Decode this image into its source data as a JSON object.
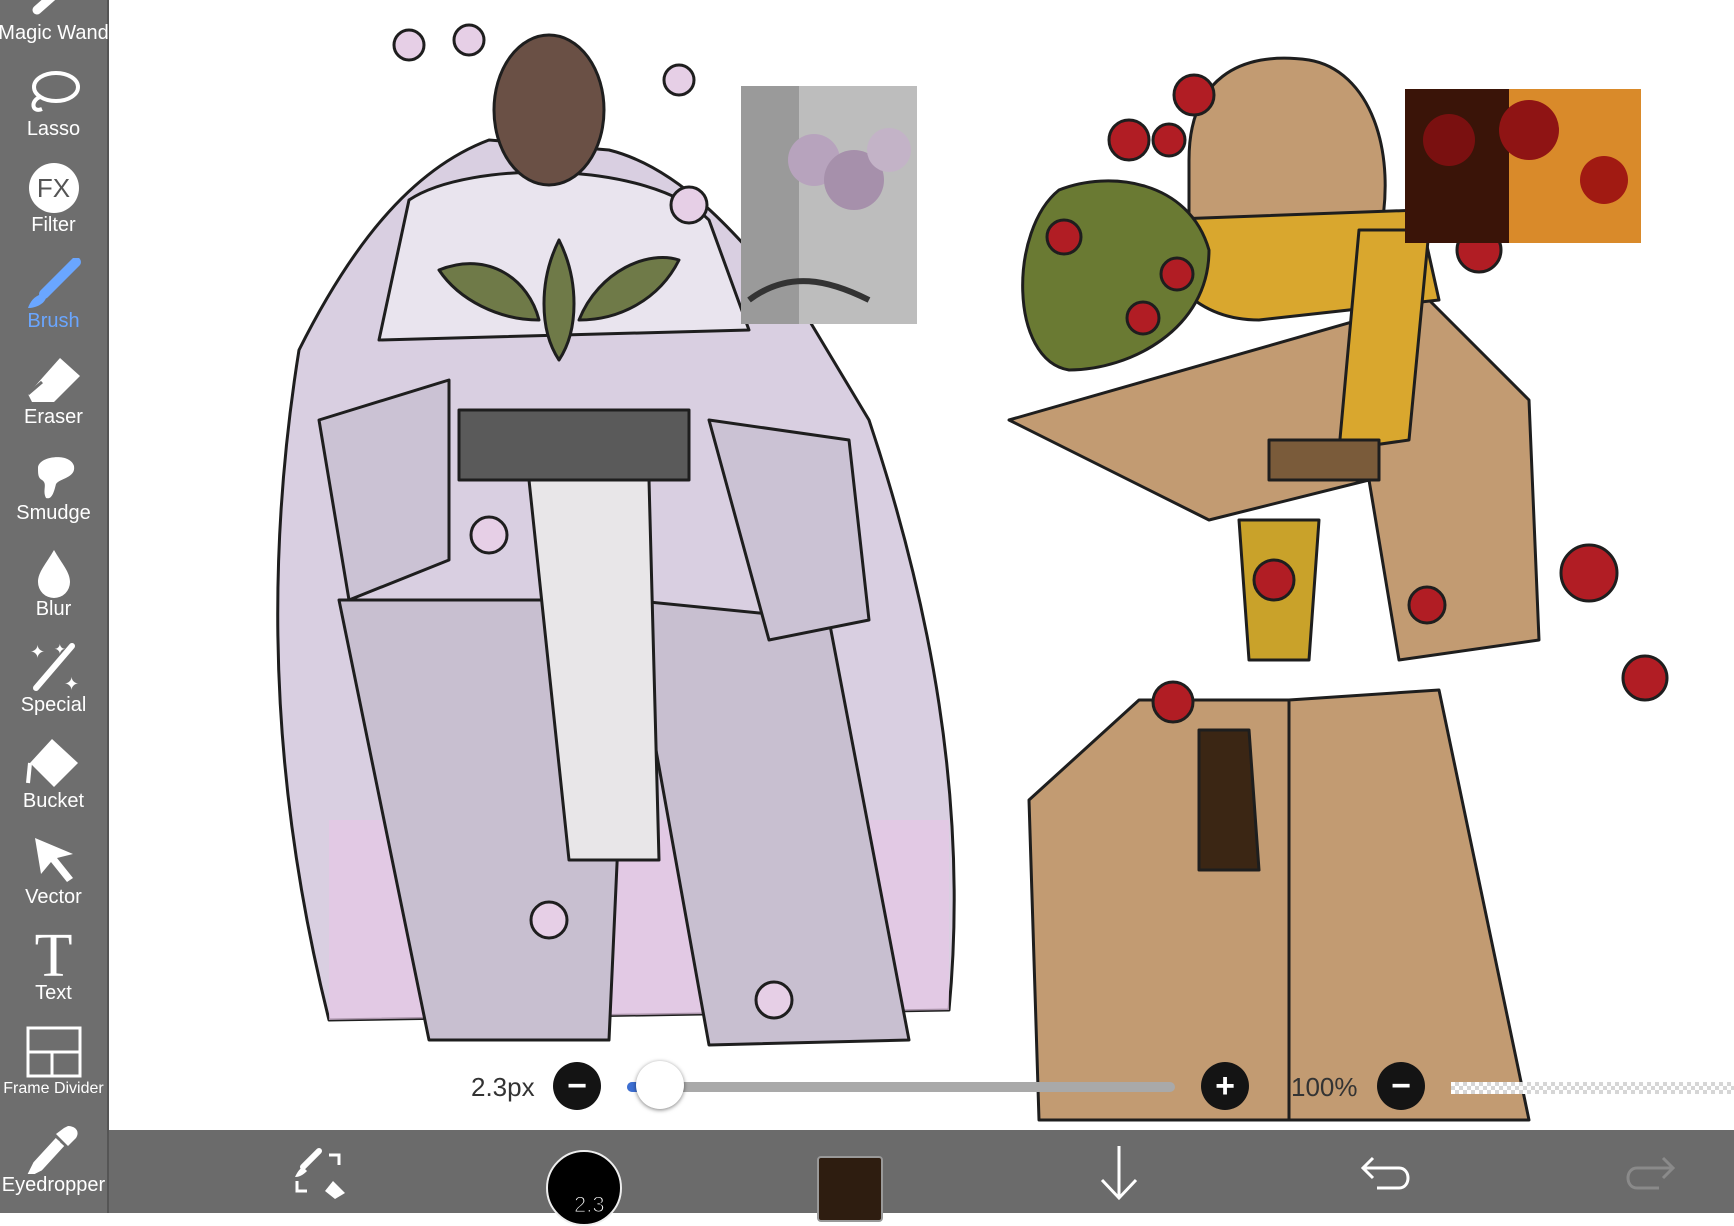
{
  "toolbar": {
    "items": [
      {
        "label": "Magic Wand",
        "icon": "magic-wand-icon"
      },
      {
        "label": "Lasso",
        "icon": "lasso-icon"
      },
      {
        "label": "Filter",
        "icon": "fx-icon",
        "icon_text": "FX"
      },
      {
        "label": "Brush",
        "icon": "brush-icon",
        "active": true
      },
      {
        "label": "Eraser",
        "icon": "eraser-icon"
      },
      {
        "label": "Smudge",
        "icon": "smudge-icon"
      },
      {
        "label": "Blur",
        "icon": "blur-drop-icon"
      },
      {
        "label": "Special",
        "icon": "sparkle-icon"
      },
      {
        "label": "Bucket",
        "icon": "bucket-icon"
      },
      {
        "label": "Vector",
        "icon": "pointer-icon"
      },
      {
        "label": "Text",
        "icon": "text-icon",
        "icon_text": "T"
      },
      {
        "label": "Frame Divider",
        "icon": "frame-divider-icon"
      },
      {
        "label": "Eyedropper",
        "icon": "eyedropper-icon"
      }
    ],
    "active_color": "#6aa6ff"
  },
  "brush_bar": {
    "size_label": "2.3px",
    "size_value": 2.3,
    "size_fraction": 0.06,
    "minus": "−",
    "plus": "+",
    "opacity_label": "100%",
    "opacity_minus": "−"
  },
  "bottom_bar": {
    "brush_size_text": "2.3",
    "current_color": "#2e1d10"
  },
  "canvas": {
    "left_figure_palette": [
      "#d4c8dc",
      "#6f7a48",
      "#5a5a5a",
      "#e8b9e0"
    ],
    "right_figure_palette": [
      "#c29b72",
      "#d9a72e",
      "#b11d24",
      "#6a7a33"
    ]
  }
}
